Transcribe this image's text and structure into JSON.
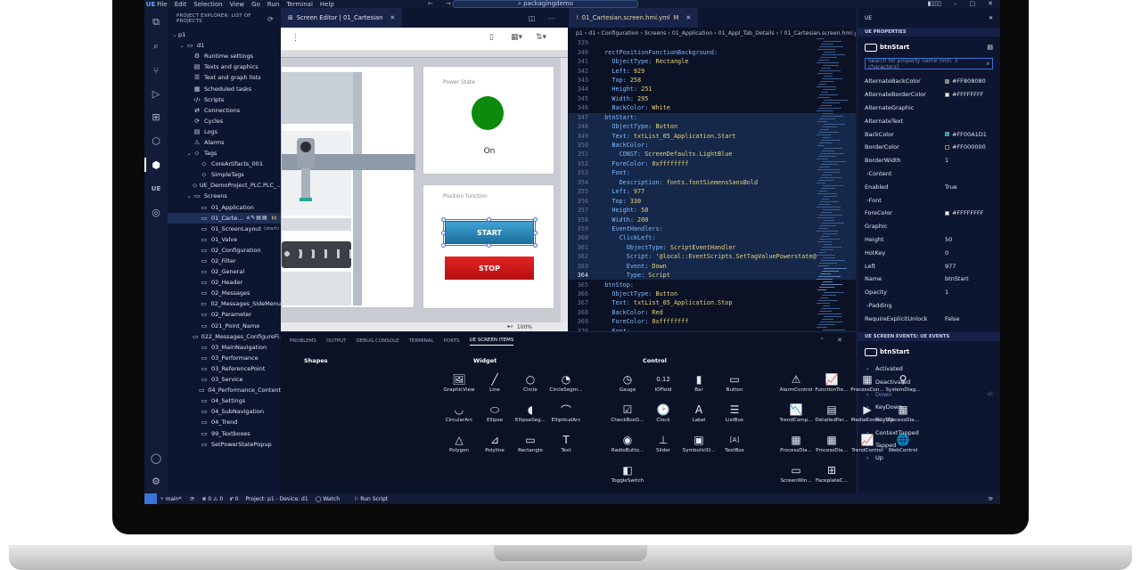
{
  "titlebar": {
    "menus": [
      "File",
      "Edit",
      "Selection",
      "View",
      "Go",
      "Run",
      "Terminal",
      "Help"
    ],
    "command_center": "packagingdemo",
    "logo": "UE"
  },
  "explorer": {
    "header": "PROJECT EXPLORER: LIST OF PROJECTS",
    "items": [
      {
        "label": "p1",
        "indent": 0,
        "chev": "⌄",
        "icon": ""
      },
      {
        "label": "d1",
        "indent": 1,
        "chev": "⌄",
        "icon": "▭"
      },
      {
        "label": "Runtime settings",
        "indent": 2,
        "chev": "",
        "icon": "⚙"
      },
      {
        "label": "Texts and graphics",
        "indent": 2,
        "chev": "",
        "icon": "▤"
      },
      {
        "label": "Text and graph lists",
        "indent": 2,
        "chev": "",
        "icon": "☰"
      },
      {
        "label": "Scheduled tasks",
        "indent": 2,
        "chev": "",
        "icon": "▦"
      },
      {
        "label": "Scripts",
        "indent": 2,
        "chev": "",
        "icon": "‹/›"
      },
      {
        "label": "Connections",
        "indent": 2,
        "chev": "",
        "icon": "⇄"
      },
      {
        "label": "Cycles",
        "indent": 2,
        "chev": "",
        "icon": "⟳"
      },
      {
        "label": "Logs",
        "indent": 2,
        "chev": "",
        "icon": "▤"
      },
      {
        "label": "Alarms",
        "indent": 2,
        "chev": "",
        "icon": "⚠"
      },
      {
        "label": "Tags",
        "indent": 2,
        "chev": "⌄",
        "icon": "⬦"
      },
      {
        "label": "CoreArtifacts_001",
        "indent": 3,
        "chev": "",
        "icon": "⬦"
      },
      {
        "label": "SimpleTags",
        "indent": 3,
        "chev": "",
        "icon": "⬦"
      },
      {
        "label": "UE_DemoProject_PLC.PLC_...",
        "indent": 3,
        "chev": "",
        "icon": "⬦"
      },
      {
        "label": "Screens",
        "indent": 2,
        "chev": "⌄",
        "icon": "▭"
      },
      {
        "label": "01_Application",
        "indent": 3,
        "chev": "",
        "icon": "▭"
      },
      {
        "label": "01_Carte...",
        "indent": 3,
        "chev": "",
        "icon": "▭",
        "selected": true,
        "modified": "M"
      },
      {
        "label": "01_ScreenLayout",
        "indent": 3,
        "chev": "",
        "icon": "▭",
        "note": "(start)"
      },
      {
        "label": "01_Valve",
        "indent": 3,
        "chev": "",
        "icon": "▭"
      },
      {
        "label": "02_Configuration",
        "indent": 3,
        "chev": "",
        "icon": "▭"
      },
      {
        "label": "02_Filter",
        "indent": 3,
        "chev": "",
        "icon": "▭"
      },
      {
        "label": "02_General",
        "indent": 3,
        "chev": "",
        "icon": "▭"
      },
      {
        "label": "02_Header",
        "indent": 3,
        "chev": "",
        "icon": "▭"
      },
      {
        "label": "02_Messages",
        "indent": 3,
        "chev": "",
        "icon": "▭"
      },
      {
        "label": "02_Messages_SideMenu",
        "indent": 3,
        "chev": "",
        "icon": "▭"
      },
      {
        "label": "02_Parameter",
        "indent": 3,
        "chev": "",
        "icon": "▭"
      },
      {
        "label": "021_Point_Name",
        "indent": 3,
        "chev": "",
        "icon": "▭"
      },
      {
        "label": "022_Messages_ConfigureFi...",
        "indent": 3,
        "chev": "",
        "icon": "▭"
      },
      {
        "label": "03_MainNavigation",
        "indent": 3,
        "chev": "",
        "icon": "▭"
      },
      {
        "label": "03_Performance",
        "indent": 3,
        "chev": "",
        "icon": "▭"
      },
      {
        "label": "03_ReferencePoint",
        "indent": 3,
        "chev": "",
        "icon": "▭"
      },
      {
        "label": "03_Service",
        "indent": 3,
        "chev": "",
        "icon": "▭"
      },
      {
        "label": "04_Performance_Content",
        "indent": 3,
        "chev": "",
        "icon": "▭"
      },
      {
        "label": "04_Settings",
        "indent": 3,
        "chev": "",
        "icon": "▭"
      },
      {
        "label": "04_SubNavigation",
        "indent": 3,
        "chev": "",
        "icon": "▭"
      },
      {
        "label": "04_Trend",
        "indent": 3,
        "chev": "",
        "icon": "▭"
      },
      {
        "label": "99_Textboxes",
        "indent": 3,
        "chev": "",
        "icon": "▭"
      },
      {
        "label": "SetPowerStatePopup",
        "indent": 3,
        "chev": "",
        "icon": "▭"
      }
    ]
  },
  "screen_editor": {
    "tab_label": "Screen Editor | 01_Cartesian",
    "power_state_label": "Power State",
    "power_on_text": "On",
    "position_label": "Position function",
    "start_label": "START",
    "stop_label": "STOP",
    "zoom": "100%",
    "colors": {
      "led": "#0b8a0b",
      "start": "#1f86bd",
      "stop": "#d41818"
    }
  },
  "code_editor": {
    "tab_label": "01_Cartesian.screen.hmi.yml",
    "tab_modified": "M",
    "breadcrumb": "p1 › d1 › Configuration › Screens › 01_Application › 01_Appl_Tab_Details › ! 01_Cartesian.screen.hmi.yml",
    "current_line": 364,
    "lines": [
      {
        "n": "339",
        "indent": "",
        "key": "",
        "val": ""
      },
      {
        "n": "340",
        "indent": "  ",
        "key": "rectPositionFunctionBackground:",
        "val": ""
      },
      {
        "n": "341",
        "indent": "    ",
        "key": "ObjectType:",
        "val": " Rectangle"
      },
      {
        "n": "342",
        "indent": "    ",
        "key": "Left:",
        "val": " 929"
      },
      {
        "n": "343",
        "indent": "    ",
        "key": "Top:",
        "val": " 258"
      },
      {
        "n": "344",
        "indent": "    ",
        "key": "Height:",
        "val": " 251"
      },
      {
        "n": "345",
        "indent": "    ",
        "key": "Width:",
        "val": " 295"
      },
      {
        "n": "346",
        "indent": "    ",
        "key": "BackColor:",
        "val": " White"
      },
      {
        "n": "347",
        "indent": "  ",
        "key": "btnStart:",
        "val": "",
        "hl": true
      },
      {
        "n": "348",
        "indent": "    ",
        "key": "ObjectType:",
        "val": " Button",
        "hl": true
      },
      {
        "n": "349",
        "indent": "    ",
        "key": "Text:",
        "val": " txtList_05_Application.Start",
        "hl": true
      },
      {
        "n": "350",
        "indent": "    ",
        "key": "BackColor:",
        "val": "",
        "hl": true
      },
      {
        "n": "351",
        "indent": "      ",
        "key": "CONST:",
        "val": " ScreenDefaults.LightBlue",
        "hl": true
      },
      {
        "n": "352",
        "indent": "    ",
        "key": "ForeColor:",
        "val": " 0xffffffff",
        "hl": true
      },
      {
        "n": "353",
        "indent": "    ",
        "key": "Font:",
        "val": "",
        "hl": true
      },
      {
        "n": "354",
        "indent": "      ",
        "key": "Description:",
        "val": " fonts.fontSiemensSansBold",
        "hl": true
      },
      {
        "n": "355",
        "indent": "    ",
        "key": "Left:",
        "val": " 977",
        "hl": true
      },
      {
        "n": "356",
        "indent": "    ",
        "key": "Top:",
        "val": " 330",
        "hl": true
      },
      {
        "n": "357",
        "indent": "    ",
        "key": "Height:",
        "val": " 50",
        "hl": true
      },
      {
        "n": "358",
        "indent": "    ",
        "key": "Width:",
        "val": " 200",
        "hl": true
      },
      {
        "n": "359",
        "indent": "    ",
        "key": "EventHandlers:",
        "val": "",
        "hl": true
      },
      {
        "n": "360",
        "indent": "      ",
        "key": "ClickLeft:",
        "val": "",
        "hl": true
      },
      {
        "n": "361",
        "indent": "        ",
        "key": "ObjectType:",
        "val": " ScriptEventHandler",
        "hl": true
      },
      {
        "n": "362",
        "indent": "        ",
        "key": "Script:",
        "val": " '@local::EventScripts.SetTagValuePowerstate@",
        "hl": true
      },
      {
        "n": "363",
        "indent": "        ",
        "key": "Event:",
        "val": " Down",
        "hl": true
      },
      {
        "n": "364",
        "indent": "        ",
        "key": "Type:",
        "val": " Script",
        "hl": true
      },
      {
        "n": "365",
        "indent": "  ",
        "key": "btnStop:",
        "val": ""
      },
      {
        "n": "366",
        "indent": "    ",
        "key": "ObjectType:",
        "val": " Button"
      },
      {
        "n": "367",
        "indent": "    ",
        "key": "Text:",
        "val": " txtList_05_Application.Stop"
      },
      {
        "n": "368",
        "indent": "    ",
        "key": "BackColor:",
        "val": " Red"
      },
      {
        "n": "369",
        "indent": "    ",
        "key": "ForeColor:",
        "val": " 0xffffffff"
      },
      {
        "n": "370",
        "indent": "    ",
        "key": "Font:",
        "val": ""
      }
    ]
  },
  "properties": {
    "panel_title": "UE",
    "section_title": "UE PROPERTIES",
    "object_name": "btnStart",
    "search_placeholder": "Search for property name (min. 3 characters)",
    "rows": [
      {
        "name": "AlternateBackColor",
        "value": "#FF808080",
        "swatch": "#808080"
      },
      {
        "name": "AlternateBorderColor",
        "value": "#FFFFFFFF",
        "swatch": "#ffffff"
      },
      {
        "name": "AlternateGraphic",
        "value": ""
      },
      {
        "name": "AlternateText",
        "value": ""
      },
      {
        "name": "BackColor",
        "value": "#FF00A1D1",
        "swatch": "#00a1d1"
      },
      {
        "name": "BorderColor",
        "value": "#FF000000",
        "swatch": "#000000"
      },
      {
        "name": "BorderWidth",
        "value": "1"
      },
      {
        "name": "Content",
        "value": "",
        "expander": true
      },
      {
        "name": "Enabled",
        "value": "True"
      },
      {
        "name": "Font",
        "value": "",
        "expander": true
      },
      {
        "name": "ForeColor",
        "value": "#FFFFFFFF",
        "swatch": "#ffffff"
      },
      {
        "name": "Graphic",
        "value": ""
      },
      {
        "name": "Height",
        "value": "50"
      },
      {
        "name": "HotKey",
        "value": "0"
      },
      {
        "name": "Left",
        "value": "977"
      },
      {
        "name": "Name",
        "value": "btnStart"
      },
      {
        "name": "Opacity",
        "value": "1"
      },
      {
        "name": "Padding",
        "value": "",
        "expander": true
      },
      {
        "name": "RequireExplicitUnlock",
        "value": "False"
      }
    ],
    "events_title": "UE SCREEN EVENTS: UE EVENTS",
    "events_object": "btnStart",
    "events": [
      {
        "name": "Activated"
      },
      {
        "name": "Deactivated"
      },
      {
        "name": "Down",
        "active": true
      },
      {
        "name": "KeyDown"
      },
      {
        "name": "KeyUp"
      },
      {
        "name": "ContextTapped"
      },
      {
        "name": "Tapped"
      },
      {
        "name": "Up"
      }
    ]
  },
  "bottom_panel": {
    "tabs": [
      "PROBLEMS",
      "OUTPUT",
      "DEBUG CONSOLE",
      "TERMINAL",
      "PORTS",
      "UE SCREEN ITEMS"
    ],
    "active_tab": "UE SCREEN ITEMS",
    "shapes_title": "Shapes",
    "widget_title": "Widget",
    "control_title": "Control",
    "shapes": [
      {
        "label": "GraphicView",
        "icon": "🖼"
      },
      {
        "label": "Line",
        "icon": "╱"
      },
      {
        "label": "Circle",
        "icon": "○"
      },
      {
        "label": "CircleSegm...",
        "icon": "◔"
      },
      {
        "label": "CircularArc",
        "icon": "◡"
      },
      {
        "label": "Ellipse",
        "icon": "⬭"
      },
      {
        "label": "EllipseSeg...",
        "icon": "◖"
      },
      {
        "label": "EllipticalArc",
        "icon": "⌒"
      },
      {
        "label": "Polygon",
        "icon": "△"
      },
      {
        "label": "Polyline",
        "icon": "⊿"
      },
      {
        "label": "Rectangle",
        "icon": "▭"
      },
      {
        "label": "Text",
        "icon": "T"
      }
    ],
    "widgets": [
      {
        "label": "Gauge",
        "icon": "◷"
      },
      {
        "label": "IOField",
        "icon": "0.12"
      },
      {
        "label": "Bar",
        "icon": "▮"
      },
      {
        "label": "Button",
        "icon": "▭"
      },
      {
        "label": "CheckBoxG...",
        "icon": "☑"
      },
      {
        "label": "Clock",
        "icon": "🕑"
      },
      {
        "label": "Label",
        "icon": "A"
      },
      {
        "label": "ListBox",
        "icon": "☰"
      },
      {
        "label": "RadioButto...",
        "icon": "◉"
      },
      {
        "label": "Slider",
        "icon": "⊥"
      },
      {
        "label": "SymbolicIO...",
        "icon": "▣"
      },
      {
        "label": "TextBox",
        "icon": "[A]"
      },
      {
        "label": "ToggleSwitch",
        "icon": "◧"
      }
    ],
    "controls": [
      {
        "label": "AlarmControl",
        "icon": "⚠"
      },
      {
        "label": "FunctionTre...",
        "icon": "📈"
      },
      {
        "label": "ProcessCon...",
        "icon": "▦"
      },
      {
        "label": "SystemDiag...",
        "icon": "⚲"
      },
      {
        "label": "TrendComp...",
        "icon": "📉"
      },
      {
        "label": "DetailedPar...",
        "icon": "▤"
      },
      {
        "label": "MediaContr...",
        "icon": "▶"
      },
      {
        "label": "ProcessDia...",
        "icon": "▦"
      },
      {
        "label": "ProcessDia...",
        "icon": "▦"
      },
      {
        "label": "ProcessDia...",
        "icon": "▦"
      },
      {
        "label": "TrendControl",
        "icon": "📈"
      },
      {
        "label": "WebControl",
        "icon": "🌐"
      },
      {
        "label": "ScreenWin...",
        "icon": "▭"
      },
      {
        "label": "FaceplateC...",
        "icon": "⊞"
      }
    ]
  },
  "statusbar": {
    "branch": "main*",
    "problems": "⊗ 0 ⚠ 0",
    "ports": "⑈ 0",
    "project": "Project: p1 - Device: d1",
    "watch": "Watch",
    "run_script": "Run Script"
  }
}
